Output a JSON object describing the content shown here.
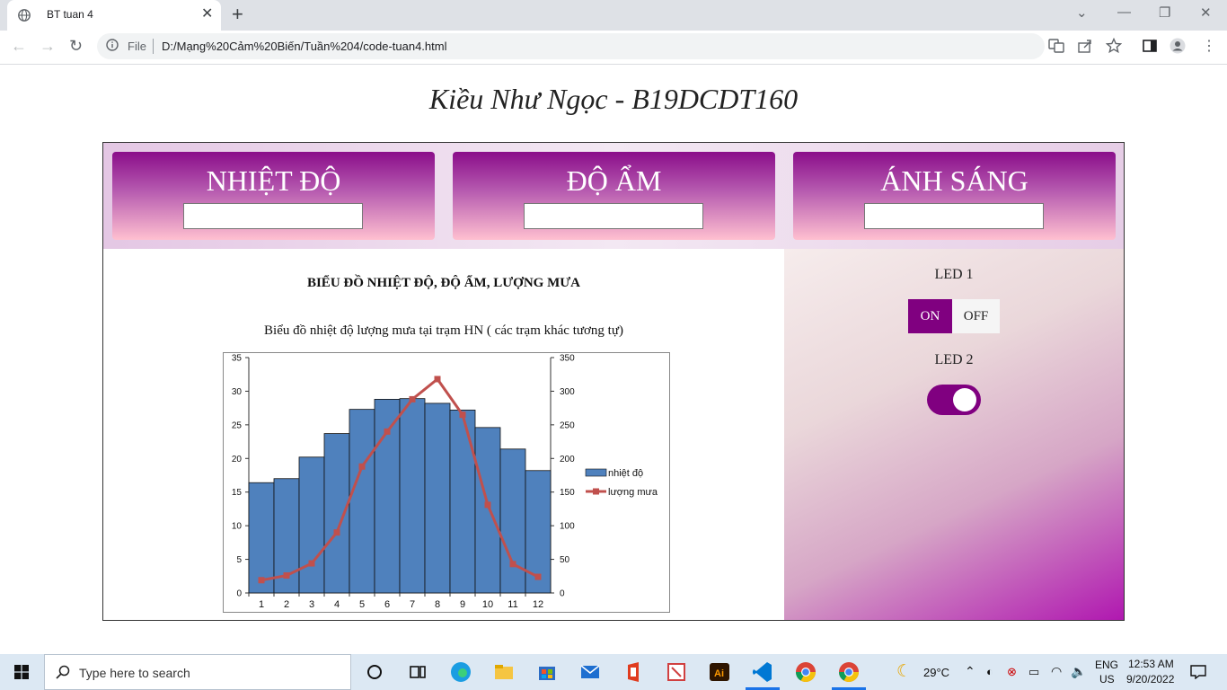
{
  "browser": {
    "tab_title": "BT tuan 4",
    "omnibox_prefix": "File",
    "url": "D:/Mạng%20Cảm%20Biến/Tuần%204/code-tuan4.html"
  },
  "page": {
    "title": "Kiều Như Ngọc - B19DCDT160",
    "sensors": [
      {
        "label": "NHIỆT ĐỘ",
        "value": ""
      },
      {
        "label": "ĐỘ ẨM",
        "value": ""
      },
      {
        "label": "ÁNH SÁNG",
        "value": ""
      }
    ],
    "chart_heading": "BIỂU ĐỒ NHIỆT ĐỘ, ĐỘ ẨM, LƯỢNG MƯA",
    "chart_caption": "Biểu đồ nhiệt độ lượng mưa tại trạm HN ( các trạm khác tương tự)",
    "led1": {
      "label": "LED 1",
      "on_label": "ON",
      "off_label": "OFF",
      "state": "on"
    },
    "led2": {
      "label": "LED 2",
      "state": "on"
    }
  },
  "chart_data": {
    "type": "bar",
    "categories": [
      "1",
      "2",
      "3",
      "4",
      "5",
      "6",
      "7",
      "8",
      "9",
      "10",
      "11",
      "12"
    ],
    "series": [
      {
        "name": "nhiệt độ",
        "type": "bar",
        "axis": "left",
        "color": "#4f81bd",
        "values": [
          16.4,
          17.0,
          20.2,
          23.7,
          27.3,
          28.8,
          28.9,
          28.2,
          27.2,
          24.6,
          21.4,
          18.2
        ]
      },
      {
        "name": "lượng mưa",
        "type": "line",
        "axis": "right",
        "color": "#c0504d",
        "values": [
          19,
          26,
          44,
          90,
          188,
          240,
          288,
          318,
          265,
          131,
          43,
          24
        ]
      }
    ],
    "y_left": {
      "min": 0,
      "max": 35,
      "ticks": [
        0,
        5,
        10,
        15,
        20,
        25,
        30,
        35
      ]
    },
    "y_right": {
      "min": 0,
      "max": 350,
      "ticks": [
        0,
        50,
        100,
        150,
        200,
        250,
        300,
        350
      ]
    },
    "legend": "right"
  },
  "taskbar": {
    "search_placeholder": "Type here to search",
    "weather": "29°C",
    "lang_top": "ENG",
    "lang_bottom": "US",
    "time": "12:53 AM",
    "date": "9/20/2022"
  }
}
